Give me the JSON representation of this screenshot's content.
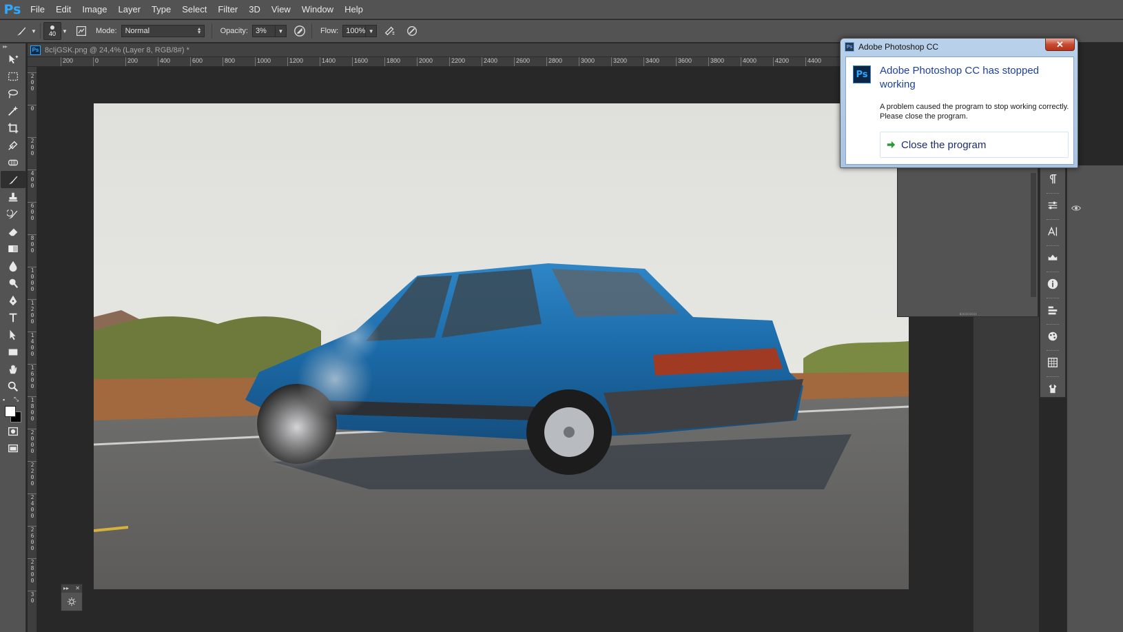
{
  "app": {
    "logo": "Ps",
    "menu": [
      "File",
      "Edit",
      "Image",
      "Layer",
      "Type",
      "Select",
      "Filter",
      "3D",
      "View",
      "Window",
      "Help"
    ]
  },
  "options": {
    "brush_size": "40",
    "mode_label": "Mode:",
    "mode_value": "Normal",
    "opacity_label": "Opacity:",
    "opacity_value": "3%",
    "flow_label": "Flow:",
    "flow_value": "100%"
  },
  "document": {
    "tab_title": "8cIjGSK.png @ 24,4% (Layer 8, RGB/8#) *"
  },
  "ruler_h": [
    "200",
    "0",
    "200",
    "400",
    "600",
    "800",
    "1000",
    "1200",
    "1400",
    "1600",
    "1800",
    "2000",
    "2200",
    "2400",
    "2600",
    "2800",
    "3000",
    "3200",
    "3400",
    "3600",
    "3800",
    "4000",
    "4200",
    "4400"
  ],
  "ruler_v": [
    "2\n0\n0",
    "0",
    "2\n0\n0",
    "4\n0\n0",
    "6\n0\n0",
    "8\n0\n0",
    "1\n0\n0\n0",
    "1\n2\n0\n0",
    "1\n4\n0\n0",
    "1\n6\n0\n0",
    "1\n8\n0\n0",
    "2\n0\n0\n0",
    "2\n2\n0\n0",
    "2\n4\n0\n0",
    "2\n6\n0\n0",
    "2\n8\n0\n0",
    "3\n0"
  ],
  "tools": [
    "move-tool",
    "marquee-tool",
    "lasso-tool",
    "magic-wand-tool",
    "crop-tool",
    "eyedropper-tool",
    "healing-brush-tool",
    "brush-tool",
    "clone-stamp-tool",
    "history-brush-tool",
    "eraser-tool",
    "gradient-tool",
    "blur-tool",
    "dodge-tool",
    "pen-tool",
    "type-tool",
    "path-selection-tool",
    "rectangle-tool",
    "hand-tool",
    "zoom-tool"
  ],
  "colors": {
    "foreground": "#ffffff",
    "background": "#000000",
    "ui_bg": "#535353",
    "canvas_bg": "#282828",
    "accent": "#31a8ff"
  },
  "dock_icons": [
    "paragraph-icon",
    "adjustments-icon",
    "character-icon",
    "glyphs-icon",
    "info-icon",
    "clone-source-icon",
    "brush-presets-icon",
    "swatches-icon",
    "tool-presets-icon"
  ],
  "dialog": {
    "title": "Adobe Photoshop CC",
    "close_glyph": "✕",
    "icon_text": "Ps",
    "heading": "Adobe Photoshop CC has stopped working",
    "message": "A problem caused the program to stop working correctly. Please close the program.",
    "action": "Close the program"
  }
}
